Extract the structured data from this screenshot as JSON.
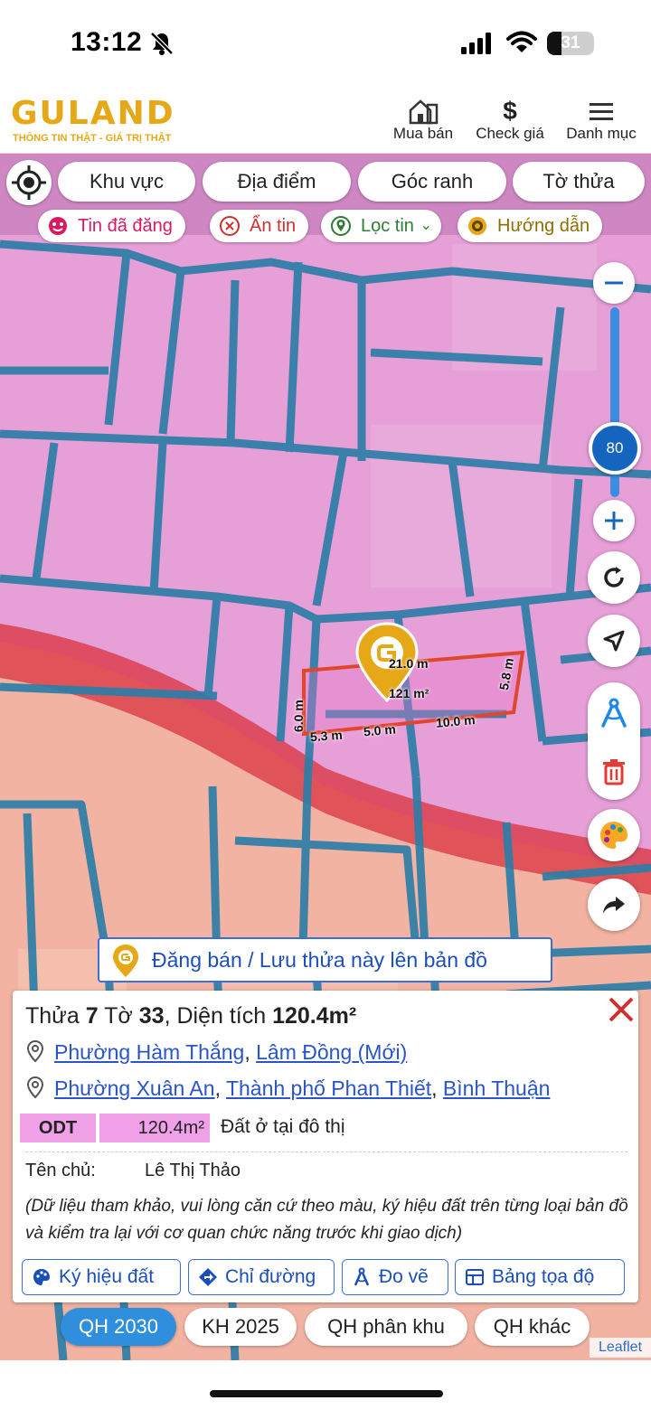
{
  "status": {
    "time": "13:12",
    "battery": "31",
    "battery_level": 0.31
  },
  "header": {
    "logo": "GULAND",
    "tagline": "THÔNG TIN THẬT - GIÁ TRỊ THẬT",
    "buttons": [
      {
        "label": "Mua bán",
        "icon": "house-icon"
      },
      {
        "label": "Check giá",
        "icon": "dollar-icon"
      },
      {
        "label": "Danh mục",
        "icon": "menu-icon"
      }
    ]
  },
  "map": {
    "search_chips": [
      "Khu vực",
      "Địa điểm",
      "Góc ranh",
      "Tờ thửa"
    ],
    "filters": [
      {
        "label": "Tin đã đăng",
        "color": "#d81b60",
        "icon": "smiley-icon"
      },
      {
        "label": "Ẩn tin",
        "color": "#d32f2f",
        "icon": "x-circle-icon"
      },
      {
        "label": "Lọc tin",
        "color": "#2e7d32",
        "icon": "pin-icon"
      },
      {
        "label": "Hướng dẫn",
        "color": "#8d6e00",
        "icon": "play-circle-icon"
      }
    ],
    "zoom_level": "80",
    "parcel": {
      "area": "121 m²",
      "edges": [
        "21.0 m",
        "5.8 m",
        "10.0 m",
        "5.0 m",
        "5.3 m",
        "6.0 m"
      ]
    },
    "post_banner": "Đăng bán / Lưu thửa này lên bản đồ",
    "colors": {
      "zone_pink": "#e79fd8",
      "zone_salmon": "#f2b3a3",
      "boundary": "#2d7ea8",
      "red_band": "#d9333f",
      "parcel_outline": "#e0462b",
      "accent": "#2f8fdc",
      "brand": "#e6a817"
    }
  },
  "panel": {
    "title": {
      "prefix": "Thửa ",
      "lot": "7",
      "mid": " Tờ ",
      "sheet": "33",
      "area_label": ", Diện tích ",
      "area": "120.4m²"
    },
    "address_new": {
      "ward": "Phường Hàm Thắng",
      "province": "Lâm Đồng (Mới)"
    },
    "address_old": {
      "ward": "Phường Xuân An",
      "city": "Thành phố Phan Thiết",
      "province": "Bình Thuận"
    },
    "land_code": "ODT",
    "land_area": "120.4m²",
    "land_desc": "Đất ở tại đô thị",
    "owner_label": "Tên chủ:",
    "owner_value": "Lê Thị Thảo",
    "disclaimer": "(Dữ liệu tham khảo, vui lòng căn cứ theo màu, ký hiệu đất trên từng loại bản đồ và kiểm tra lại với cơ quan chức năng trước khi giao dịch)",
    "actions": [
      "Ký hiệu đất",
      "Chỉ đường",
      "Đo vẽ",
      "Bảng tọa độ"
    ]
  },
  "tabs": [
    {
      "label": "QH 2030",
      "active": true
    },
    {
      "label": "KH 2025",
      "active": false
    },
    {
      "label": "QH phân khu",
      "active": false
    },
    {
      "label": "QH khác",
      "active": false
    }
  ],
  "attribution": "Leaflet"
}
